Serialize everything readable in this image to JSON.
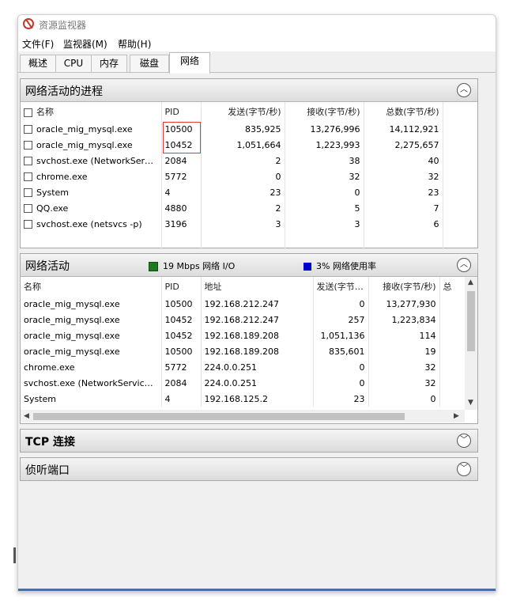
{
  "window": {
    "title": "资源监视器"
  },
  "menu": [
    "文件(F)",
    "监视器(M)",
    "帮助(H)"
  ],
  "tabs": [
    {
      "label": "概述",
      "active": false
    },
    {
      "label": "CPU",
      "active": false
    },
    {
      "label": "内存",
      "active": false
    },
    {
      "label": "磁盘",
      "active": false
    },
    {
      "label": "网络",
      "active": true
    }
  ],
  "processes": {
    "title": "网络活动的进程",
    "columns": [
      "名称",
      "PID",
      "发送(字节/秒)",
      "接收(字节/秒)",
      "总数(字节/秒)"
    ],
    "rows": [
      [
        "oracle_mig_mysql.exe",
        "10500",
        "835,925",
        "13,276,996",
        "14,112,921"
      ],
      [
        "oracle_mig_mysql.exe",
        "10452",
        "1,051,664",
        "1,223,993",
        "2,275,657"
      ],
      [
        "svchost.exe (NetworkServic...",
        "2084",
        "2",
        "38",
        "40"
      ],
      [
        "chrome.exe",
        "5772",
        "0",
        "32",
        "32"
      ],
      [
        "System",
        "4",
        "23",
        "0",
        "23"
      ],
      [
        "QQ.exe",
        "4880",
        "2",
        "5",
        "7"
      ],
      [
        "svchost.exe (netsvcs -p)",
        "3196",
        "3",
        "3",
        "6"
      ]
    ]
  },
  "network": {
    "title": "网络活动",
    "io_label": "19 Mbps 网络 I/O",
    "io_color": "#1f7a1f",
    "usage_label": "3% 网络使用率",
    "usage_color": "#0000cc",
    "columns": [
      "名称",
      "PID",
      "地址",
      "发送(字节/...",
      "接收(字节/秒)",
      "总"
    ],
    "rows": [
      [
        "oracle_mig_mysql.exe",
        "10500",
        "192.168.212.247",
        "0",
        "13,277,930"
      ],
      [
        "oracle_mig_mysql.exe",
        "10452",
        "192.168.212.247",
        "257",
        "1,223,834"
      ],
      [
        "oracle_mig_mysql.exe",
        "10452",
        "192.168.189.208",
        "1,051,136",
        "114"
      ],
      [
        "oracle_mig_mysql.exe",
        "10500",
        "192.168.189.208",
        "835,601",
        "19"
      ],
      [
        "chrome.exe",
        "5772",
        "224.0.0.251",
        "0",
        "32"
      ],
      [
        "svchost.exe (NetworkService -p)",
        "2084",
        "224.0.0.251",
        "0",
        "32"
      ],
      [
        "System",
        "4",
        "192.168.125.2",
        "23",
        "0"
      ]
    ]
  },
  "tcp": {
    "title": "TCP 连接"
  },
  "listen": {
    "title": "侦听端口"
  }
}
